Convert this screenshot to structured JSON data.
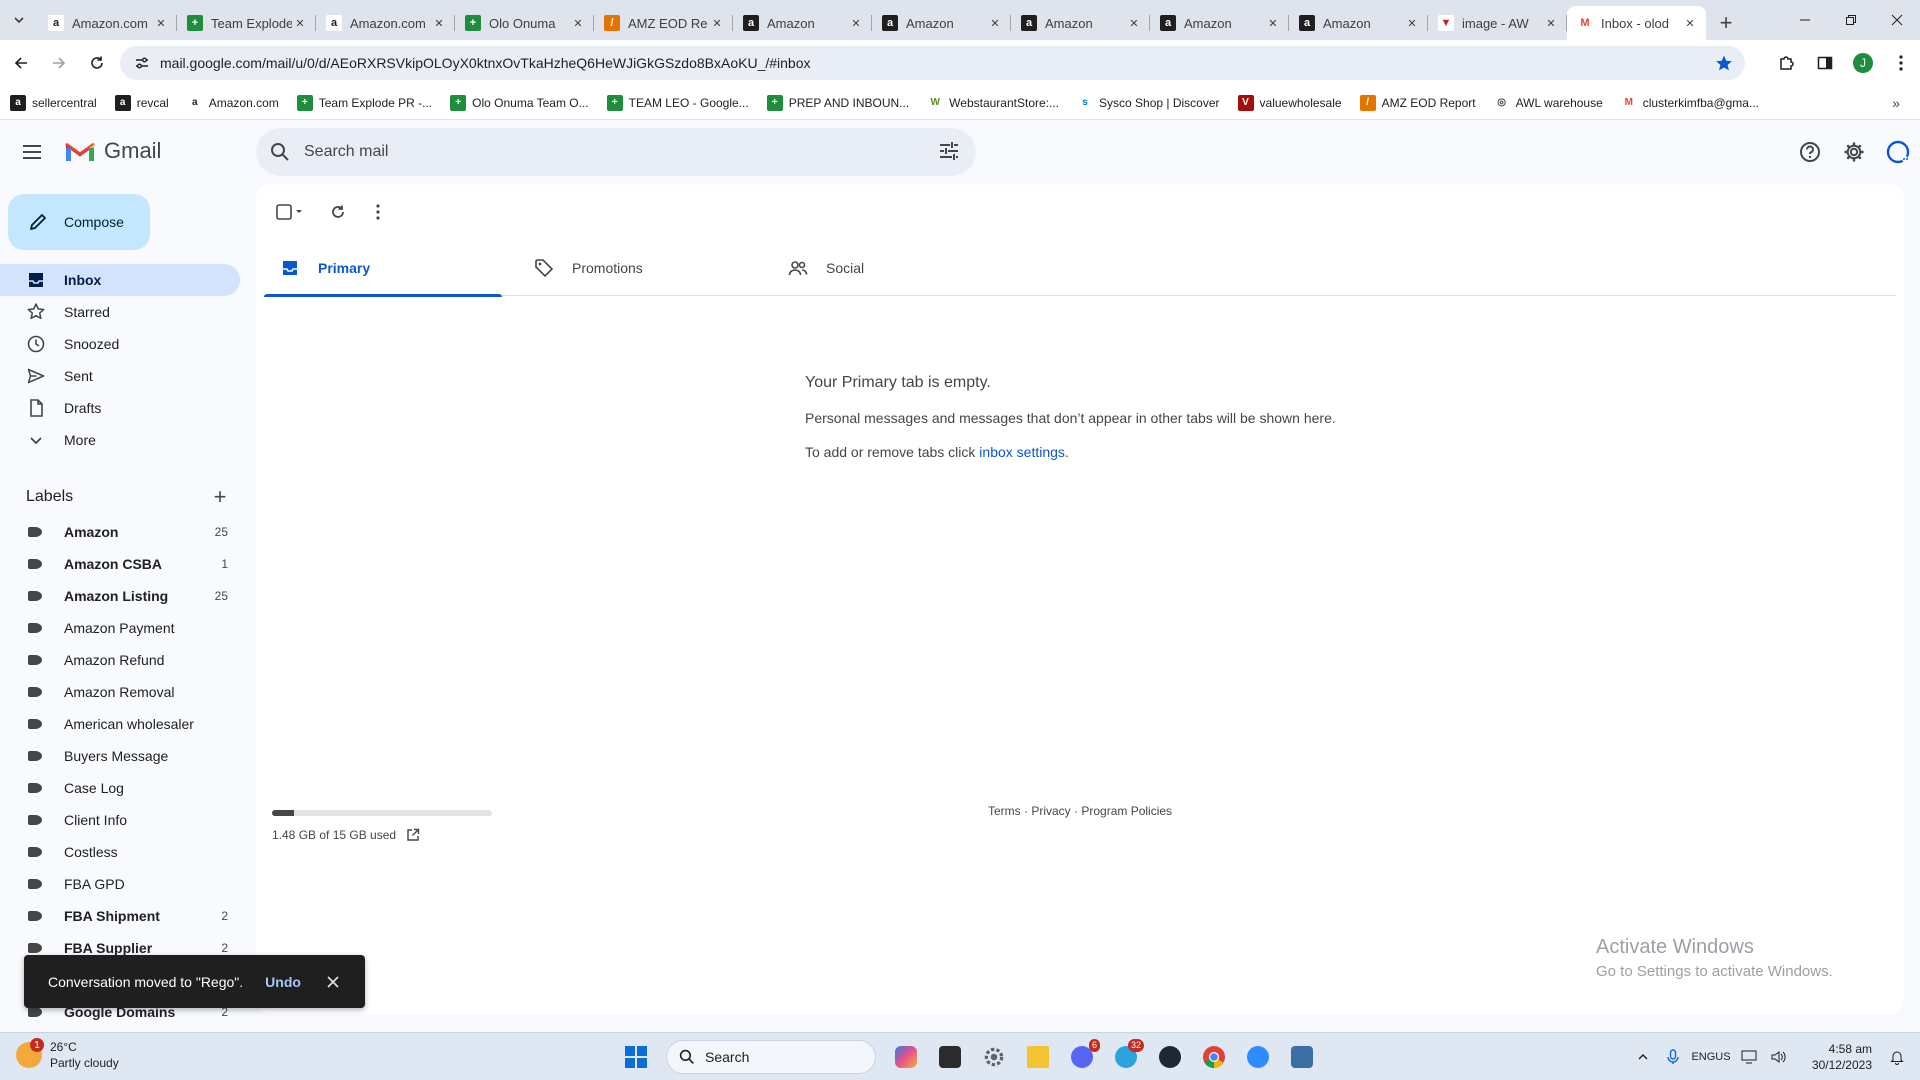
{
  "browser": {
    "tabs": [
      {
        "title": "Amazon.com",
        "icon": "amazon-icon",
        "active": false
      },
      {
        "title": "Team Explode",
        "icon": "sheets-icon",
        "active": false
      },
      {
        "title": "Amazon.com",
        "icon": "amazon-icon",
        "active": false
      },
      {
        "title": "Olo Onuma",
        "icon": "sheets-icon",
        "active": false
      },
      {
        "title": "AMZ EOD Re",
        "icon": "report-icon",
        "active": false
      },
      {
        "title": "Amazon",
        "icon": "amazon-a-icon",
        "active": false
      },
      {
        "title": "Amazon",
        "icon": "amazon-a-icon",
        "active": false
      },
      {
        "title": "Amazon",
        "icon": "amazon-a-icon",
        "active": false
      },
      {
        "title": "Amazon",
        "icon": "amazon-a-icon",
        "active": false
      },
      {
        "title": "Amazon",
        "icon": "amazon-a-icon",
        "active": false
      },
      {
        "title": "image - AW",
        "icon": "image-icon",
        "active": false
      },
      {
        "title": "Inbox - olod",
        "icon": "gmail-icon",
        "active": true
      }
    ],
    "url": "mail.google.com/mail/u/0/d/AEoRXRSVkipOLOyX0ktnxOvTkaHzheQ6HeWJiGkGSzdo8BxAoKU_/#inbox",
    "profile_initial": "J",
    "bookmarks": [
      {
        "label": "sellercentral",
        "icon": "amazon-a-icon"
      },
      {
        "label": "revcal",
        "icon": "amazon-a-icon"
      },
      {
        "label": "Amazon.com",
        "icon": "amazon-icon"
      },
      {
        "label": "Team Explode PR -...",
        "icon": "sheets-icon"
      },
      {
        "label": "Olo Onuma Team O...",
        "icon": "sheets-icon"
      },
      {
        "label": "TEAM LEO - Google...",
        "icon": "sheets-icon"
      },
      {
        "label": "PREP AND INBOUN...",
        "icon": "sheets-icon"
      },
      {
        "label": "WebstaurantStore:...",
        "icon": "webstaurant-icon"
      },
      {
        "label": "Sysco Shop | Discover",
        "icon": "sysco-icon"
      },
      {
        "label": "valuewholesale",
        "icon": "vw-icon"
      },
      {
        "label": "AMZ EOD Report",
        "icon": "report-icon"
      },
      {
        "label": "AWL warehouse",
        "icon": "globe-icon"
      },
      {
        "label": "clusterkimfba@gma...",
        "icon": "gmail-icon"
      }
    ]
  },
  "gmail": {
    "brand": "Gmail",
    "search_placeholder": "Search mail",
    "compose_label": "Compose",
    "nav": [
      {
        "label": "Inbox",
        "icon": "inbox-icon",
        "active": true
      },
      {
        "label": "Starred",
        "icon": "star-icon",
        "active": false
      },
      {
        "label": "Snoozed",
        "icon": "clock-icon",
        "active": false
      },
      {
        "label": "Sent",
        "icon": "send-icon",
        "active": false
      },
      {
        "label": "Drafts",
        "icon": "draft-icon",
        "active": false
      },
      {
        "label": "More",
        "icon": "chevron-down-icon",
        "active": false
      }
    ],
    "labels_title": "Labels",
    "labels": [
      {
        "name": "Amazon",
        "count": "25",
        "bold": true
      },
      {
        "name": "Amazon CSBA",
        "count": "1",
        "bold": true
      },
      {
        "name": "Amazon Listing",
        "count": "25",
        "bold": true
      },
      {
        "name": "Amazon Payment",
        "count": "",
        "bold": false
      },
      {
        "name": "Amazon Refund",
        "count": "",
        "bold": false
      },
      {
        "name": "Amazon Removal",
        "count": "",
        "bold": false
      },
      {
        "name": "American wholesaler",
        "count": "",
        "bold": false
      },
      {
        "name": "Buyers Message",
        "count": "",
        "bold": false
      },
      {
        "name": "Case Log",
        "count": "",
        "bold": false
      },
      {
        "name": "Client Info",
        "count": "",
        "bold": false
      },
      {
        "name": "Costless",
        "count": "",
        "bold": false
      },
      {
        "name": "FBA GPD",
        "count": "",
        "bold": false
      },
      {
        "name": "FBA Shipment",
        "count": "2",
        "bold": true
      },
      {
        "name": "FBA Supplier",
        "count": "2",
        "bold": true
      },
      {
        "name": "",
        "count": "",
        "bold": false
      },
      {
        "name": "Google Domains",
        "count": "2",
        "bold": true
      }
    ],
    "inbox_tabs": [
      {
        "label": "Primary",
        "icon": "inbox-icon",
        "active": true
      },
      {
        "label": "Promotions",
        "icon": "tag-icon",
        "active": false
      },
      {
        "label": "Social",
        "icon": "people-icon",
        "active": false
      }
    ],
    "empty_title": "Your Primary tab is empty.",
    "empty_desc": "Personal messages and messages that don’t appear in other tabs will be shown here.",
    "empty_hint_prefix": "To add or remove tabs click ",
    "empty_hint_link": "inbox settings",
    "empty_hint_suffix": ".",
    "storage_text": "1.48 GB of 15 GB used",
    "storage_fraction": 0.0987,
    "footer_terms": "Terms",
    "footer_privacy": "Privacy",
    "footer_policies": "Program Policies",
    "footer_sep": " · ",
    "snackbar_text": "Conversation moved to \"Rego\".",
    "snackbar_action": "Undo"
  },
  "watermark": {
    "line1": "Activate Windows",
    "line2": "Go to Settings to activate Windows."
  },
  "taskbar": {
    "temperature": "26°C",
    "weather": "Partly cloudy",
    "weather_badge": "1",
    "search_label": "Search",
    "discord_badge": "6",
    "telegram_badge": "32",
    "lang_line1": "ENG",
    "lang_line2": "US",
    "time": "4:58 am",
    "date": "30/12/2023"
  },
  "colors": {
    "accent": "#0b57d0",
    "compose_bg": "#c2e7ff",
    "nav_active": "#d3e3fd",
    "gmail_red": "#ea4335"
  }
}
